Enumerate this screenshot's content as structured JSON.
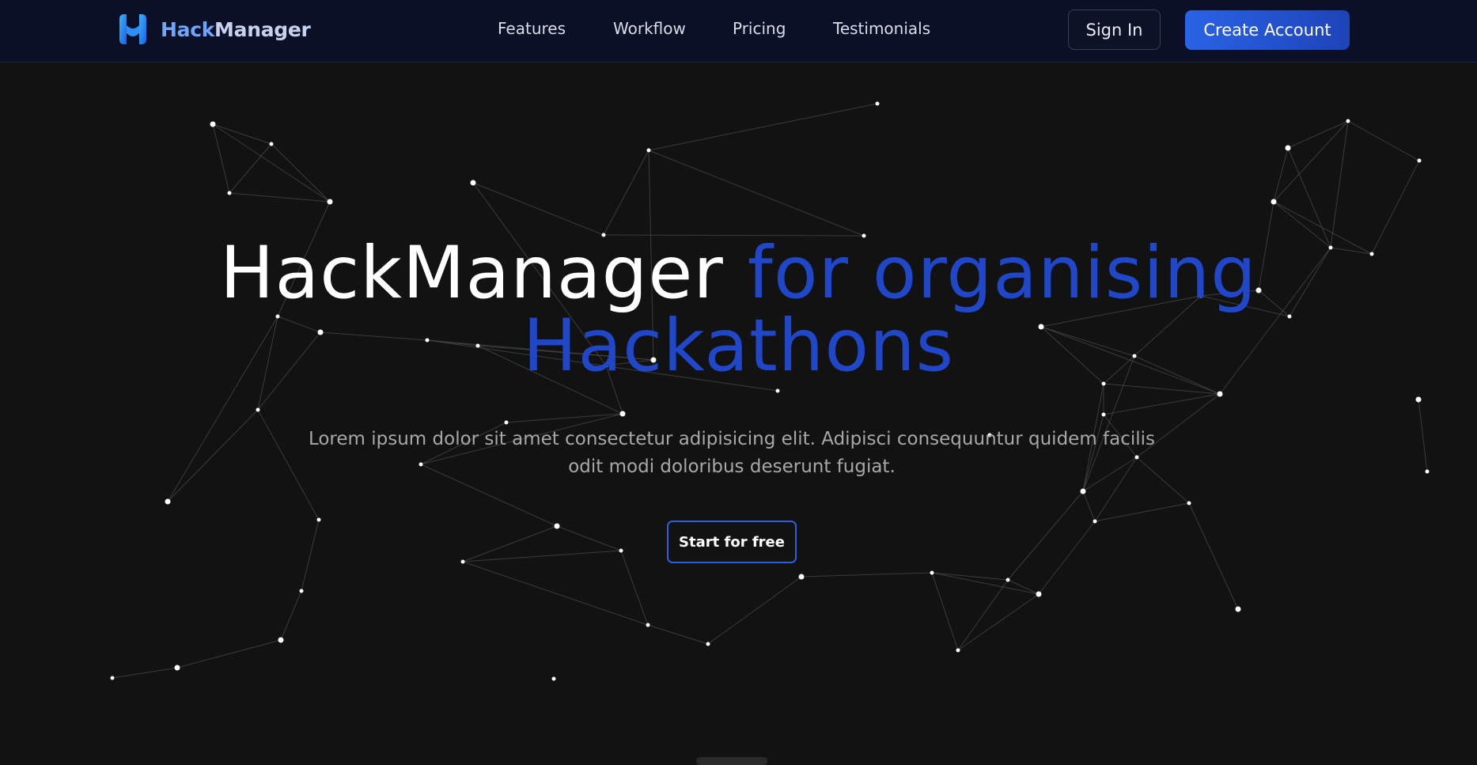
{
  "brand": {
    "name_part1": "Hack",
    "name_part2": "Manager",
    "logo_icon": "h-logo-icon"
  },
  "nav": {
    "links": [
      {
        "label": "Features"
      },
      {
        "label": "Workflow"
      },
      {
        "label": "Pricing"
      },
      {
        "label": "Testimonials"
      }
    ],
    "sign_in": "Sign In",
    "create_account": "Create Account"
  },
  "hero": {
    "title_white": "HackManager",
    "title_blue_1": "for organising",
    "title_blue_2": "Hackathons",
    "subtitle": "Lorem ipsum dolor sit amet consectetur adipisicing elit. Adipisci consequuntur quidem facilis odit modi doloribus deserunt fugiat.",
    "cta": "Start for free"
  },
  "colors": {
    "navbar_bg": "#0b1027",
    "page_bg": "#121212",
    "accent_blue": "#2147c9",
    "button_blue": "#2a63e6",
    "brand_light_blue": "#6ea6ff"
  }
}
